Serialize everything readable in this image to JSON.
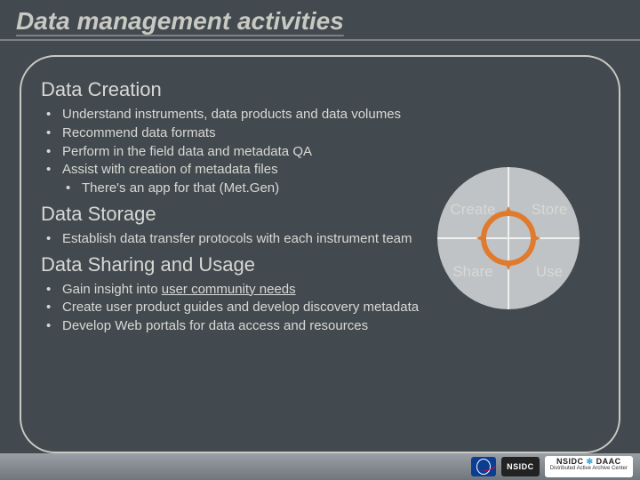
{
  "title": "Data management activities",
  "sections": {
    "creation": {
      "heading": "Data Creation",
      "b0": "Understand instruments, data products and data volumes",
      "b1": "Recommend data formats",
      "b2": "Perform in the field data and metadata QA",
      "b3": "Assist with creation of metadata files",
      "b3a": "There's an app for that (Met.Gen)"
    },
    "storage": {
      "heading": "Data Storage",
      "b0": "Establish data transfer protocols with each instrument team"
    },
    "sharing": {
      "heading": "Data Sharing and Usage",
      "b0_pre": "Gain insight into ",
      "b0_u": "user community needs",
      "b1": "Create user product guides and develop discovery metadata",
      "b2": "Develop Web portals for data access and resources"
    }
  },
  "diagram": {
    "q1": "Create",
    "q2": "Store",
    "q3": "Share",
    "q4": "Use"
  },
  "footer": {
    "nasa": "NASA",
    "nsidc": "NSIDC",
    "daac_line1_a": "NSIDC",
    "daac_line1_b": "DAAC",
    "daac_line2": "Distributed Active Archive Center"
  }
}
